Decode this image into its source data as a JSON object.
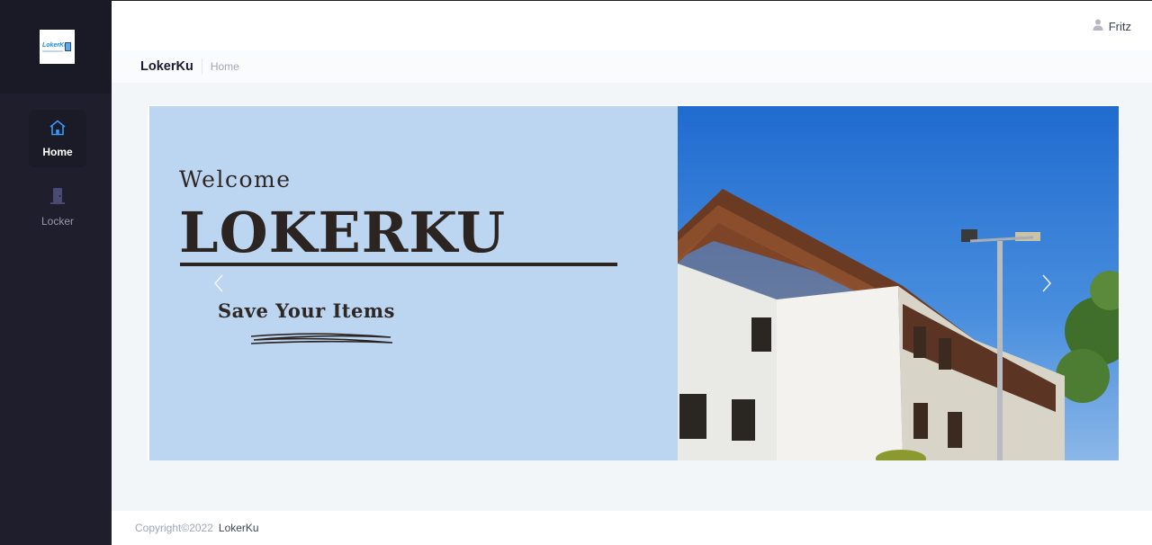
{
  "sidebar": {
    "logo_text": "LokerKu",
    "items": [
      {
        "label": "Home",
        "icon": "home-icon",
        "active": true
      },
      {
        "label": "Locker",
        "icon": "door-icon",
        "active": false
      }
    ]
  },
  "topbar": {
    "user_name": "Fritz",
    "user_icon": "user-icon"
  },
  "subheader": {
    "title": "LokerKu",
    "breadcrumb": "Home"
  },
  "banner": {
    "welcome": "Welcome",
    "title": "LOKERKU",
    "tagline": "Save Your Items"
  },
  "footer": {
    "copyright": "Copyright©2022",
    "brand": "LokerKu"
  },
  "colors": {
    "sidebar": "#1e1e2d",
    "accent": "#3699ff",
    "banner_bg": "#bcd5f0",
    "text_dark": "#2b2421"
  }
}
